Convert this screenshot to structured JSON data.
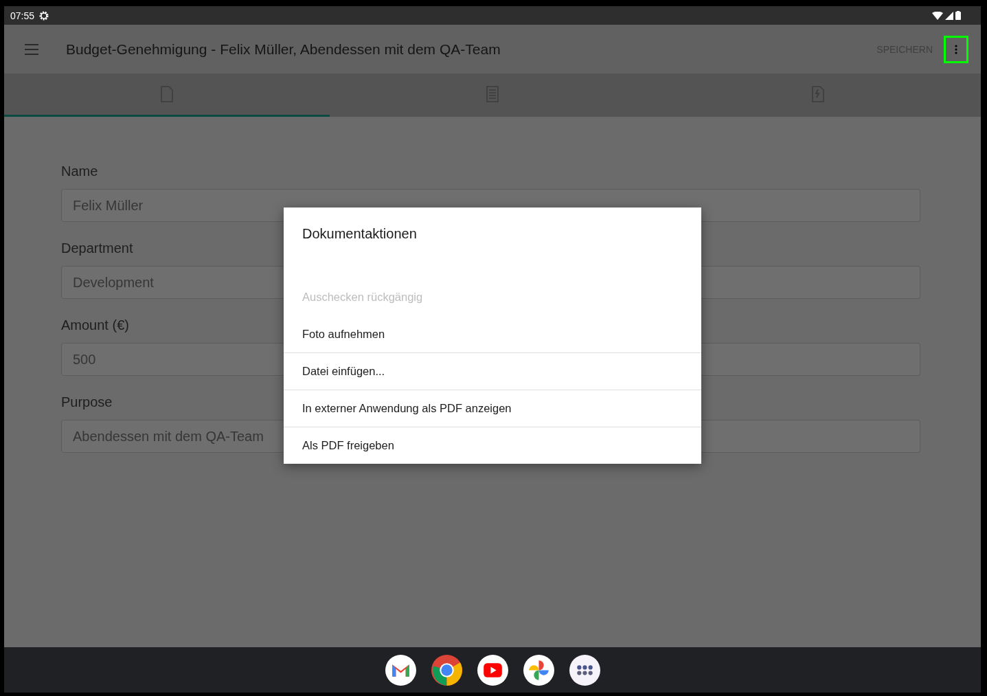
{
  "status_bar": {
    "time": "07:55"
  },
  "app_bar": {
    "title": "Budget-Genehmigung - Felix Müller, Abendessen mit dem QA-Team",
    "save_button": {
      "label": "SPEICHERN",
      "disabled": true
    },
    "more_button": {
      "highlighted": true
    }
  },
  "tabs": [
    {
      "kind": "document",
      "selected": true
    },
    {
      "kind": "list",
      "selected": false
    },
    {
      "kind": "zip",
      "selected": false
    }
  ],
  "form": [
    {
      "label": "Name",
      "value": "Felix Müller"
    },
    {
      "label": "Department",
      "value": "Development"
    },
    {
      "label": "Amount (€)",
      "value": "500"
    },
    {
      "label": "Purpose",
      "value": "Abendessen mit dem QA-Team"
    }
  ],
  "dialog": {
    "title": "Dokumentaktionen",
    "items": [
      {
        "label": "Auschecken rückgängig",
        "disabled": true,
        "divider": false
      },
      {
        "label": "Foto aufnehmen",
        "disabled": false,
        "divider": false
      },
      {
        "label": "Datei einfügen...",
        "disabled": false,
        "divider": true
      },
      {
        "label": "In externer Anwendung als PDF anzeigen",
        "disabled": false,
        "divider": true
      },
      {
        "label": "Als PDF freigeben",
        "disabled": false,
        "divider": true
      }
    ]
  },
  "dock": [
    {
      "kind": "mail"
    },
    {
      "kind": "browser"
    },
    {
      "kind": "video"
    },
    {
      "kind": "photos"
    },
    {
      "kind": "apps"
    }
  ]
}
